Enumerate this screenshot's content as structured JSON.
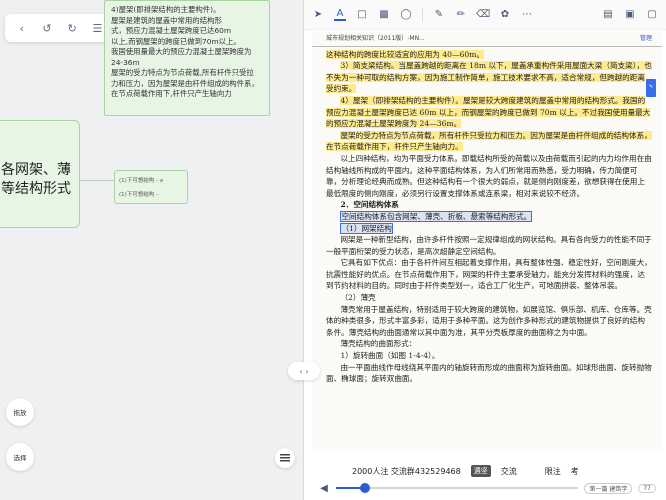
{
  "left_toolbar": {
    "icons": [
      "left-arrow-icon",
      "undo-icon",
      "redo-icon",
      "stack-icon",
      "edit-icon",
      "list-icon",
      "more-icon"
    ]
  },
  "mindmap": {
    "main_node_lines": [
      "4)屋架(即排架结构的主要构件)。",
      "屋架是建筑的屋盖中常用的结构形",
      "式，预应力混凝土屋架跨度已达60m",
      "以上,而钢屋架的跨度已做到70m以上。",
      "我国使用量最大的预应力混凝土屋架跨度为",
      "24-36m",
      "屋架的受力特点为节点荷载,所有杆件只受拉",
      "力和压力，因为屋架是由杆件组成的构件系，",
      "在节点荷载作用下,杆件只产生轴向力"
    ],
    "big_node_text": "各网架、薄 等结构形式",
    "small_node_rows": [
      "(1)下可想结构 -",
      "(1)下可想结构 -"
    ]
  },
  "left_buttons": {
    "zoom": "拖放",
    "select": "选择"
  },
  "split_toggle": "‹ ›",
  "pdf_toolbar": {
    "icons": [
      "pointer-icon",
      "text-icon",
      "rect-icon",
      "image-icon",
      "shape-icon",
      "pen-icon",
      "highlighter-icon",
      "eraser-icon",
      "lasso-icon",
      "more-icon"
    ],
    "right_icons": [
      "doc-icon",
      "page-icon",
      "fit-icon"
    ],
    "manage": "管理"
  },
  "document": {
    "header_left": "城市规划相关知识（2011版）-MN...",
    "header_right": "",
    "paragraphs": [
      {
        "text": "这种结构的跨度比较适宜的应用为 40—60m。",
        "style": "noind",
        "hl": true
      },
      {
        "text": "3）简支梁结构。当屋盖跨越的距离在 18m 以下，屋盖承重构件采用屋面大梁（简支梁），也不失为一种可取的结构方案，因为施工制作简单，施工技术要求不高，适合常规，但跨越的距离受约束。",
        "style": "sub",
        "hl": true
      },
      {
        "text": "4）屋架（即排架结构的主要构件）。屋架是较大跨度建筑的屋盖中常用的结构形式。我国的预应力混凝土屋架跨度已达 60m 以上，而钢屋架的跨度已做到 70m 以上。不过我国使用量最大的预应力混凝土屋架跨度为 24—36m。",
        "style": "sub",
        "hl": true
      },
      {
        "text": "屋架的受力特点为节点荷载，所有杆件只受拉力和压力。因为屋架是由杆件组成的结构体系，在节点荷载作用下，杆件只产生轴向力。",
        "style": "sub",
        "hl": true
      },
      {
        "text": "以上四种结构，均为平面受力体系。即载结构所受的荷载以及由荷载而引起的内力均作用在由结构轴线所构成的平面内。这种平面结构体系，为人们所常用而熟悉，受力明确，传力简便可靠，分析理论经典而成熟。但这种结构有一个很大的弱点，就是侧向刚度差，欲想获得在使用上最低限度的侧向刚度，必须另行设置支撑体系或连系梁，相对来说较不经济。",
        "style": "sub",
        "hl": false
      },
      {
        "text": "2．空间结构体系",
        "style": "h",
        "hl": false
      },
      {
        "text": "空间结构体系包含网架、薄壳、折板、悬索等结构形式。",
        "style": "sub",
        "hl": false,
        "selected": true
      },
      {
        "text": "（1）网架结构",
        "style": "sub",
        "hl": false,
        "selected": true
      },
      {
        "text": "网架是一种新型结构，由许多杆件按照一定规律组成的网状结构。具有各向受力的性能不同于一般平面桁架的受力状态，是高次超静定空间结构。",
        "style": "sub",
        "hl": false
      },
      {
        "text": "它具有如下优点：由于各杆件间互相起着支撑作用，具有整体性强、稳定性好，空间刚度大，抗震性能好的优点。在节点荷载作用下，网架的杆件主要承受轴力，能充分发挥材料的强度，达到节约材料的目的。同时由于杆件类型划一，适合工厂化生产，可地面拼装、整体吊装。",
        "style": "sub",
        "hl": false
      },
      {
        "text": "（2）薄壳",
        "style": "sub",
        "hl": false
      },
      {
        "text": "薄壳常用于屋盖结构，特别适用于较大跨度的建筑物，如展览馆、俱乐部、机库、仓库等。壳体的种类很多，形式丰富多彩，适用于多种平面。这为创作多种形式的建筑物提供了良好的结构条件。薄壳结构的曲面通常以其中面为准，其平分壳板厚度的曲面称之为中面。",
        "style": "sub",
        "hl": false
      },
      {
        "text": "薄壳结构的曲面形式：",
        "style": "sub",
        "hl": false
      },
      {
        "text": "1）旋转曲面（如图 1-4-4）。",
        "style": "sub",
        "hl": false
      },
      {
        "text": "由一平面曲线作母线绕其平面内的轴旋转而形成的曲面称为旋转曲面。如球形曲面、旋转抛物面、椭球面；旋转双曲面。",
        "style": "sub",
        "hl": false
      }
    ],
    "footer_left": "2000人注 交流群432529468",
    "footer_chip1": "遇坚",
    "footer_chip2": "交流",
    "footer_right1": "限注",
    "footer_right2": "考",
    "page_label": "第一篇 建筑学"
  },
  "scrubber": {
    "progress": 0.12,
    "page_label": "77"
  }
}
